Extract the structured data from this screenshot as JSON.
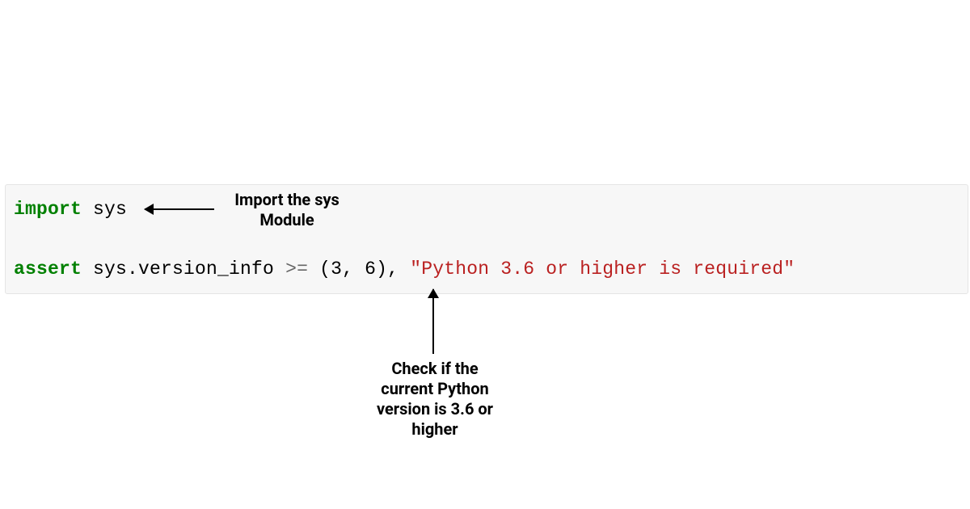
{
  "code": {
    "line1": {
      "kw": "import",
      "module": " sys"
    },
    "line2": {
      "kw": "assert",
      "expr": " sys.version_info ",
      "op": ">=",
      "sp1": " ",
      "lp": "(",
      "n1": "3",
      "c1": ", ",
      "n2": "6",
      "rp": ")",
      "c2": ", ",
      "str": "\"Python 3.6 or higher is required\""
    }
  },
  "annotations": {
    "a1_l1": "Import the sys",
    "a1_l2": "Module",
    "a2_l1": "Check if the",
    "a2_l2": "current Python",
    "a2_l3": "version is 3.6 or",
    "a2_l4": "higher"
  },
  "colors": {
    "keyword": "#008000",
    "string": "#BA2121",
    "operator": "#666666",
    "bg": "#f7f7f7"
  }
}
